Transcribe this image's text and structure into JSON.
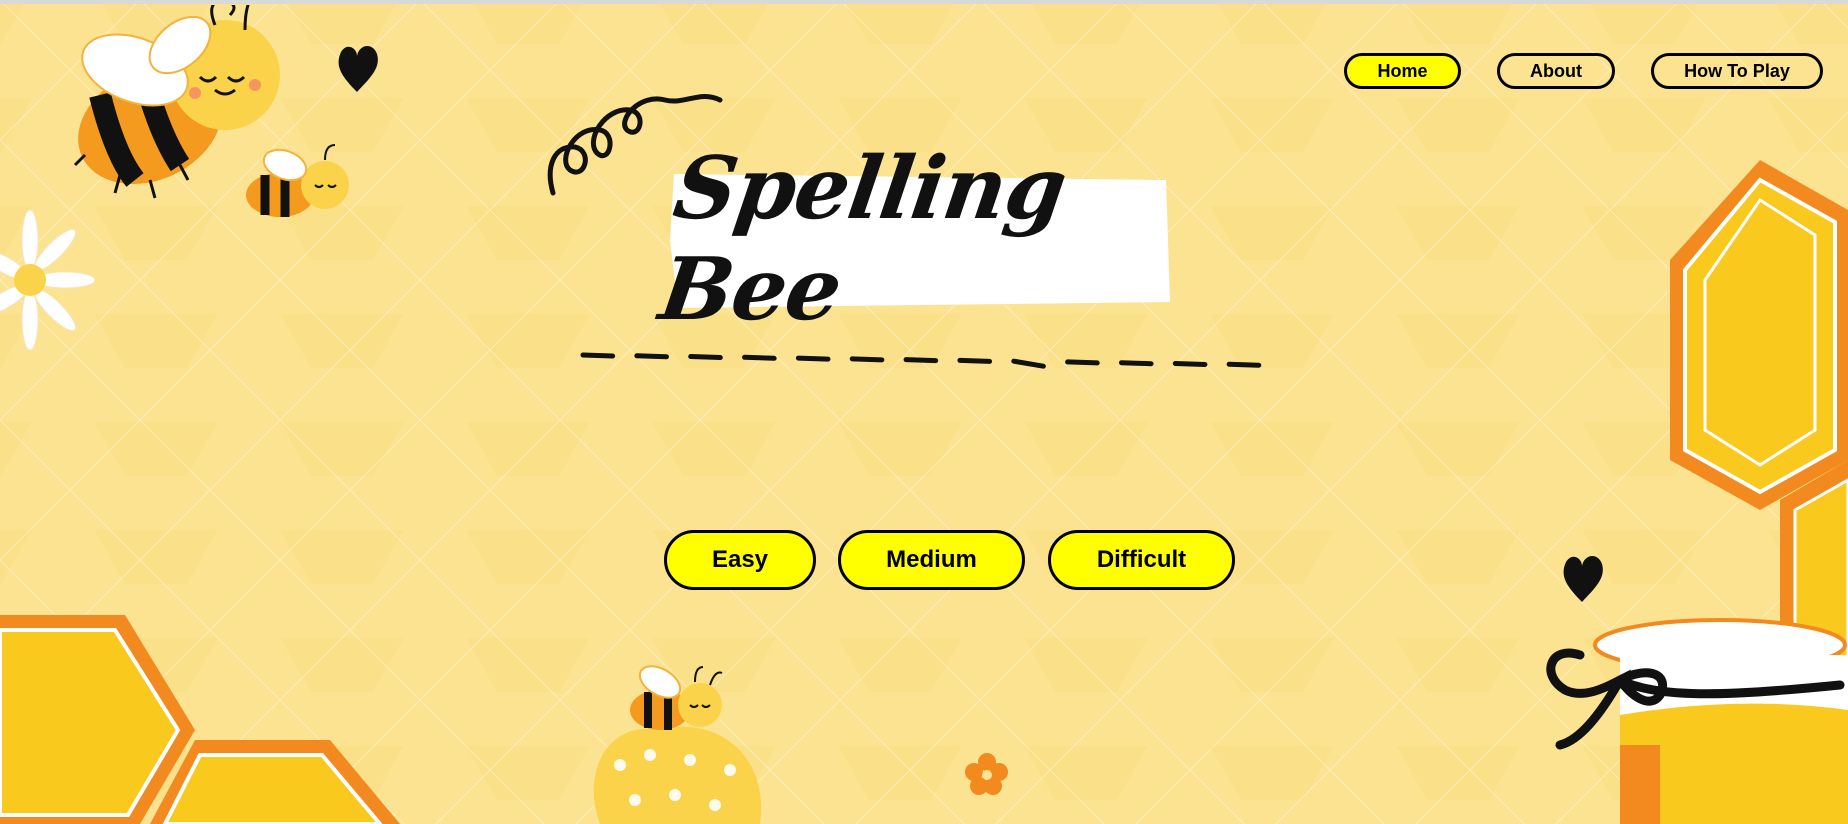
{
  "nav": {
    "home": "Home",
    "about": "About",
    "how_to_play": "How To Play"
  },
  "title": "Spelling Bee",
  "word_slots": 13,
  "levels": {
    "easy": "Easy",
    "medium": "Medium",
    "difficult": "Difficult"
  },
  "colors": {
    "background": "#fbe18a",
    "button_fill": "#ffff00",
    "honeycomb": "#f9c91e",
    "honeycomb_border": "#f28a1f",
    "bee_stripe": "#f39a1f"
  },
  "icons": [
    "bee-icon",
    "heart-icon",
    "daisy-icon",
    "honeycomb-icon",
    "honey-jar-icon",
    "swirl-icon",
    "flower-icon"
  ]
}
